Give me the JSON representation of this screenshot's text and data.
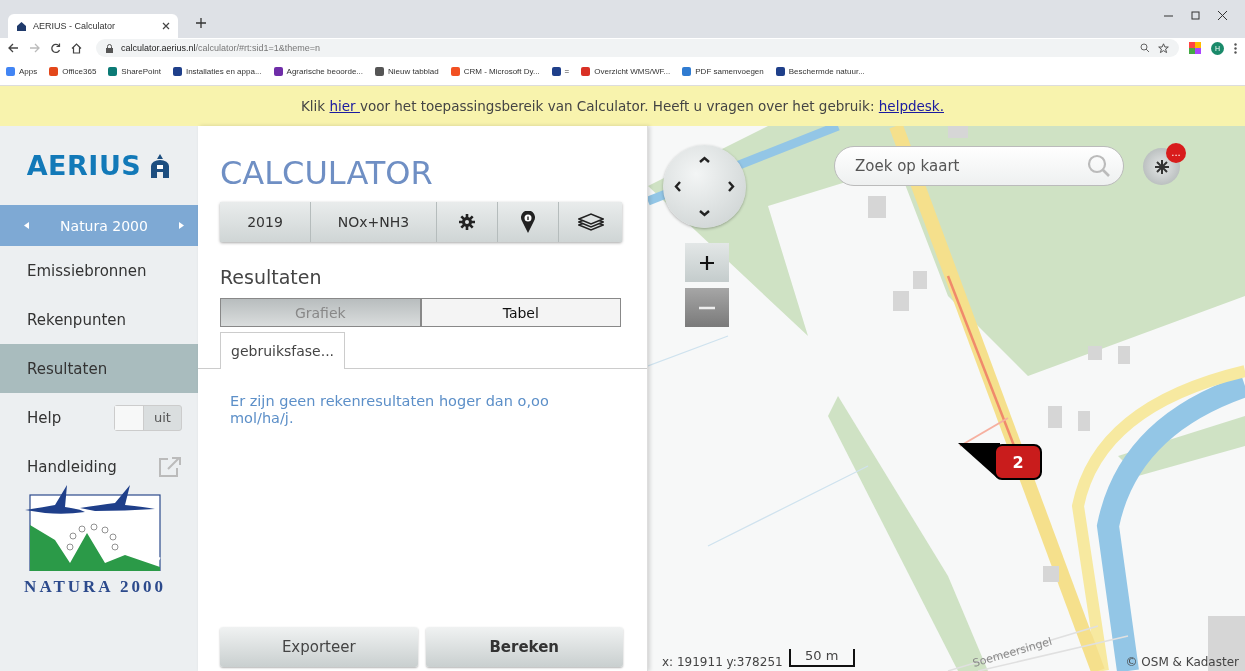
{
  "browser": {
    "tab": {
      "title": "AERIUS - Calculator",
      "selected": true
    },
    "url_host": "calculator.aerius.nl",
    "url_path": "/calculator/#rt:sid1=1&theme=n",
    "profile": "H",
    "bookmarks": [
      {
        "label": "Apps",
        "color": "#4285f4"
      },
      {
        "label": "Office365",
        "color": "#e3471a"
      },
      {
        "label": "SharePoint",
        "color": "#0b7a75"
      },
      {
        "label": "Installaties en appa...",
        "color": "#1f3f8a"
      },
      {
        "label": "Agrarische beoorde...",
        "color": "#6f2da8"
      },
      {
        "label": "Nieuw tabblad",
        "color": "#555555"
      },
      {
        "label": "CRM - Microsoft Dy...",
        "color": "#f25022"
      },
      {
        "label": "=",
        "color": "#1f3f8a"
      },
      {
        "label": "Overzicht WMS/WF...",
        "color": "#d93025"
      },
      {
        "label": "PDF samenvoegen",
        "color": "#2f7bd1"
      },
      {
        "label": "Beschermde natuur...",
        "color": "#1f3f8a"
      }
    ]
  },
  "banner": {
    "before": "Klik ",
    "link": "hier ",
    "middle": "voor het toepassingsbereik van Calculator. Heeft u vragen over het gebruik: ",
    "link2": "helpdesk."
  },
  "sidebar": {
    "logo": "AERIUS",
    "theme": "Natura 2000",
    "items": [
      {
        "label": "Emissiebronnen",
        "selected": false
      },
      {
        "label": "Rekenpunten",
        "selected": false
      },
      {
        "label": "Resultaten",
        "selected": true
      }
    ],
    "help": {
      "label": "Help",
      "toggle": "uit",
      "on": false
    },
    "manual": "Handleiding",
    "emblem": "NATURA 2000"
  },
  "panel": {
    "title": "CALCULATOR",
    "toolbar": {
      "year": "2019",
      "substance": "NOx+NH3"
    },
    "heading": "Resultaten",
    "views": [
      {
        "label": "Grafiek",
        "selected": false
      },
      {
        "label": "Tabel",
        "selected": true
      }
    ],
    "tabs": [
      {
        "label": "gebruiksfase...",
        "selected": true
      }
    ],
    "message": "Er zijn geen rekenresultaten hoger dan o,oo mol/ha/j.",
    "buttons": [
      {
        "label": "Exporteer",
        "primary": false
      },
      {
        "label": "Bereken",
        "primary": true
      }
    ]
  },
  "map": {
    "search": {
      "placeholder": "Zoek op kaart"
    },
    "notification": "...",
    "marker": "2",
    "street": "Soemeersingel",
    "coordinates": "x: 191911 y:378251",
    "scale": "50 m",
    "attribution": "© OSM & Kadaster"
  }
}
